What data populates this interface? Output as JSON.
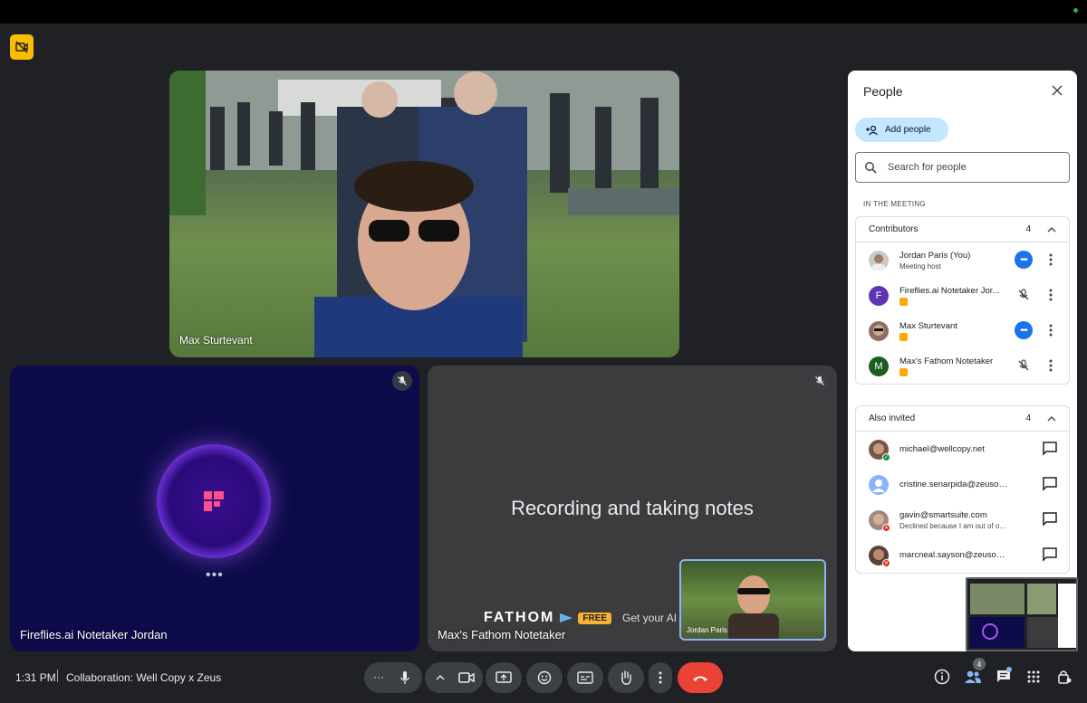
{
  "meeting": {
    "time": "1:31 PM",
    "title": "Collaboration: Well Copy x Zeus"
  },
  "tiles": {
    "main": {
      "name": "Max Sturtevant"
    },
    "fireflies": {
      "name": "Fireflies.ai Notetaker Jordan"
    },
    "fathom": {
      "name": "Max's Fathom Notetaker",
      "status_text": "Recording and taking notes",
      "brand": "FATHOM",
      "tag": "FREE",
      "cta": "Get your AI Note"
    },
    "self": {
      "name": "Jordan Paris"
    }
  },
  "people_panel": {
    "title": "People",
    "add_label": "Add people",
    "search_placeholder": "Search for people",
    "section_label": "IN THE MEETING",
    "contributors": {
      "label": "Contributors",
      "count": "4",
      "items": [
        {
          "name": "Jordan Paris (You)",
          "sub": "Meeting host",
          "initial": "",
          "color": "#c9c9c9"
        },
        {
          "name": "Fireflies.ai Notetaker Jor...",
          "sub": "",
          "initial": "F",
          "color": "#5e35b1"
        },
        {
          "name": "Max Sturtevant",
          "sub": "",
          "initial": "",
          "color": "#8d6e63"
        },
        {
          "name": "Max's Fathom Notetaker",
          "sub": "",
          "initial": "M",
          "color": "#1b5e20"
        }
      ]
    },
    "invited": {
      "label": "Also invited",
      "count": "4",
      "items": [
        {
          "name": "michael@wellcopy.net",
          "sub": "",
          "color": "#795548"
        },
        {
          "name": "cristine.senarpida@zeusos.co",
          "sub": "",
          "color": "#8ab4f8"
        },
        {
          "name": "gavin@smartsuite.com",
          "sub": "Declined because I am out of office",
          "color": "#a1887f"
        },
        {
          "name": "marcneal.sayson@zeusos.co",
          "sub": "",
          "color": "#5d4037"
        }
      ]
    }
  },
  "toolbar": {
    "people_count": "4"
  },
  "colors": {
    "accent": "#1a73e8",
    "end_call": "#ea4335",
    "background": "#202124",
    "add_button": "#c2e7ff"
  }
}
